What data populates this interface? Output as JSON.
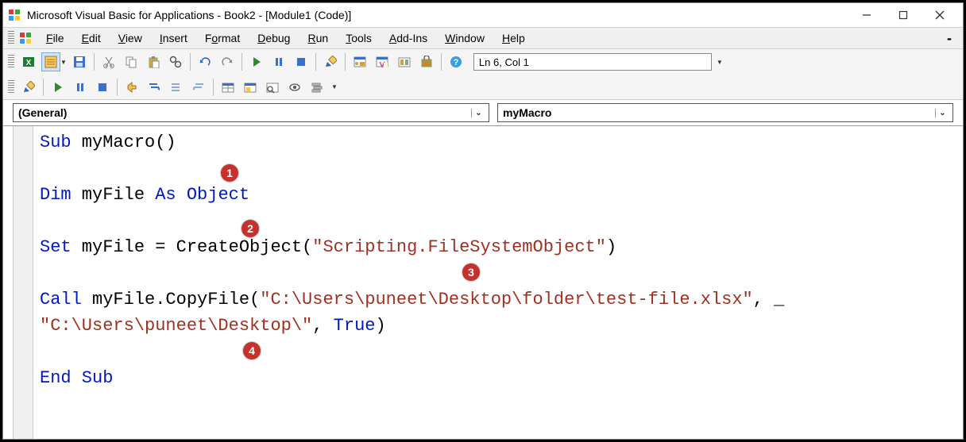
{
  "titlebar": {
    "title": "Microsoft Visual Basic for Applications - Book2 - [Module1 (Code)]"
  },
  "menubar": {
    "items": [
      "File",
      "Edit",
      "View",
      "Insert",
      "Format",
      "Debug",
      "Run",
      "Tools",
      "Add-Ins",
      "Window",
      "Help"
    ]
  },
  "toolbar1": {
    "position": "Ln 6, Col 1"
  },
  "combos": {
    "left": "(General)",
    "right": "myMacro"
  },
  "code": {
    "line1": {
      "kw1": "Sub",
      "txt": " myMacro()"
    },
    "line2": {
      "kw1": "Dim",
      "txt1": " myFile ",
      "kw2": "As",
      "txt2": " ",
      "kw3": "Object"
    },
    "line3": {
      "kw1": "Set",
      "txt1": " myFile = CreateObject(",
      "str": "\"Scripting.FileSystemObject\"",
      "txt2": ")"
    },
    "line4": {
      "kw1": "Call",
      "txt1": " myFile.CopyFile(",
      "str": "\"C:\\Users\\puneet\\Desktop\\folder\\test-file.xlsx\"",
      "txt2": ", _"
    },
    "line5": {
      "str": "\"C:\\Users\\puneet\\Desktop\\\"",
      "txt1": ", ",
      "kw1": "True",
      "txt2": ")"
    },
    "line6": {
      "kw1": "End Sub"
    }
  },
  "callouts": {
    "c1": "1",
    "c2": "2",
    "c3": "3",
    "c4": "4"
  }
}
